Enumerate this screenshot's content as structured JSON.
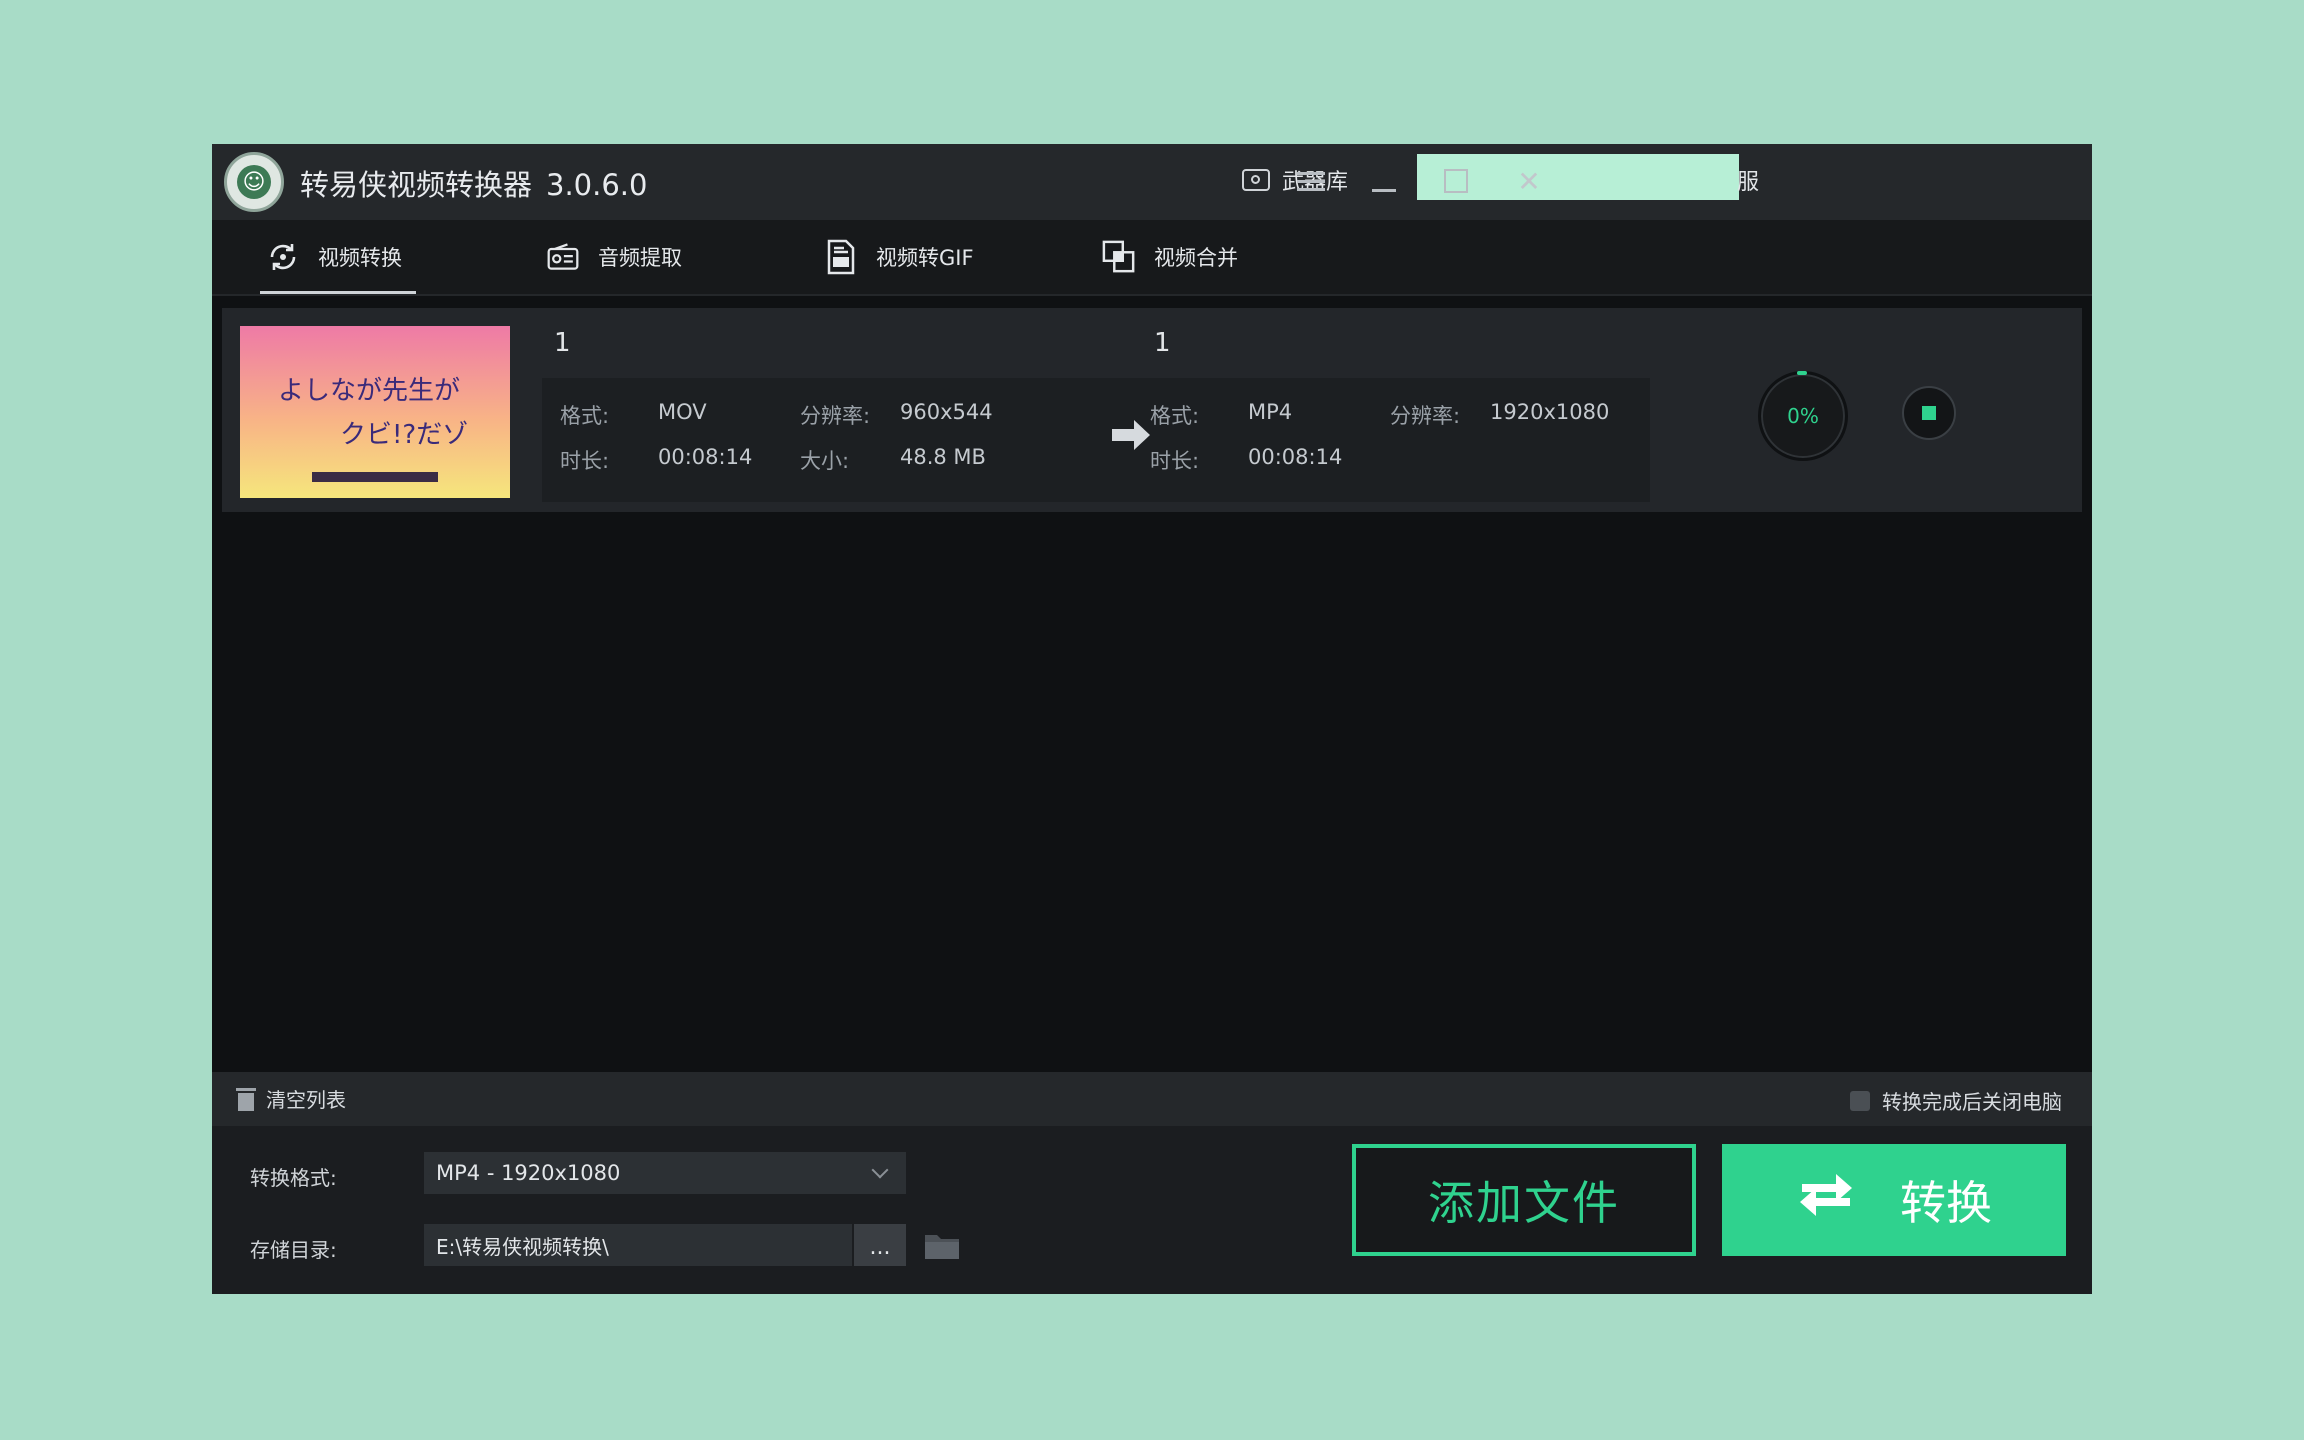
{
  "titlebar": {
    "app_name": "转易侠视频转换器",
    "version": "3.0.6.0",
    "arsenal_label": "武器库",
    "service_label": "服"
  },
  "tabs": [
    {
      "label": "视频转换",
      "icon": "convert-icon",
      "active": true
    },
    {
      "label": "音频提取",
      "icon": "radio-icon",
      "active": false
    },
    {
      "label": "视频转GIF",
      "icon": "document-icon",
      "active": false
    },
    {
      "label": "视频合并",
      "icon": "merge-icon",
      "active": false
    }
  ],
  "file": {
    "thumb_line1": "よしなが先生が",
    "thumb_line2": "クビ!?だゾ",
    "source": {
      "name": "1",
      "format_label": "格式:",
      "format": "MOV",
      "resolution_label": "分辨率:",
      "resolution": "960x544",
      "duration_label": "时长:",
      "duration": "00:08:14",
      "size_label": "大小:",
      "size": "48.8 MB"
    },
    "target": {
      "name": "1",
      "format_label": "格式:",
      "format": "MP4",
      "resolution_label": "分辨率:",
      "resolution": "1920x1080",
      "duration_label": "时长:",
      "duration": "00:08:14"
    },
    "progress": "0%"
  },
  "listbar": {
    "clear_label": "清空列表",
    "shutdown_label": "转换完成后关闭电脑"
  },
  "bottom": {
    "format_label": "转换格式:",
    "format_value": "MP4 - 1920x1080",
    "dir_label": "存储目录:",
    "dir_value": "E:\\转易侠视频转换\\",
    "browse_label": "...",
    "add_file_label": "添加文件",
    "convert_label": "转换"
  },
  "colors": {
    "accent": "#2fd28e",
    "background": "#a8dcc7",
    "window": "#0f1113"
  }
}
